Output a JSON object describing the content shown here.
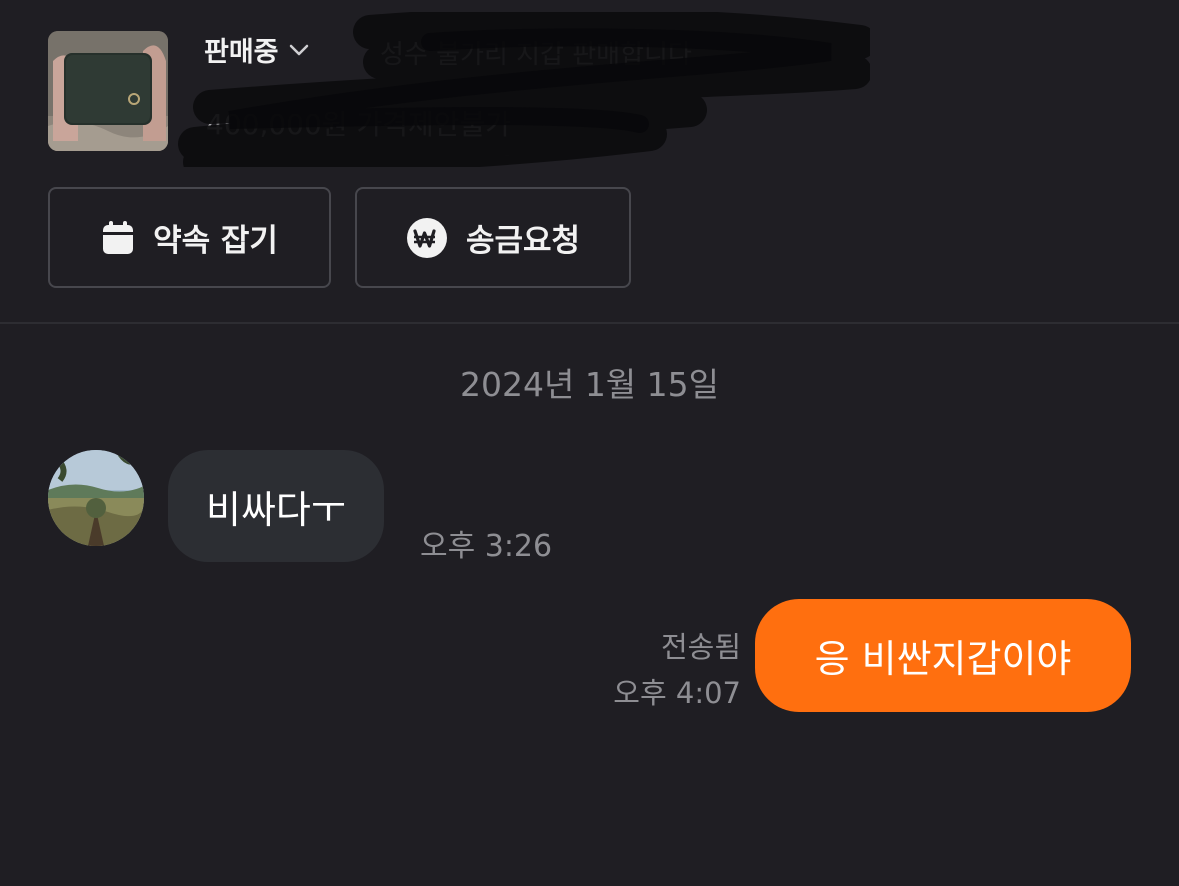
{
  "product": {
    "thumbnail": "wallet-photo",
    "status_label": "판매중",
    "title": "성수 불가리 지갑 판매합니다",
    "price": "400,000원 가격제안불가"
  },
  "actions": {
    "schedule_label": "약속 잡기",
    "schedule_icon": "calendar-icon",
    "transfer_label": "송금요청",
    "transfer_icon": "won-icon"
  },
  "chat": {
    "date": "2024년 1월 15일",
    "messages": [
      {
        "direction": "incoming",
        "avatar": "landscape-avatar",
        "text": "비싸다ㅜ",
        "time": "오후 3:26"
      },
      {
        "direction": "outgoing",
        "status": "전송됨",
        "text": "응 비싼지갑이야",
        "time": "오후 4:07"
      }
    ]
  },
  "colors": {
    "background": "#1f1e23",
    "outgoing_bubble": "#ff6f0f",
    "incoming_bubble": "#2c2e33",
    "muted_text": "#8e8e93"
  }
}
